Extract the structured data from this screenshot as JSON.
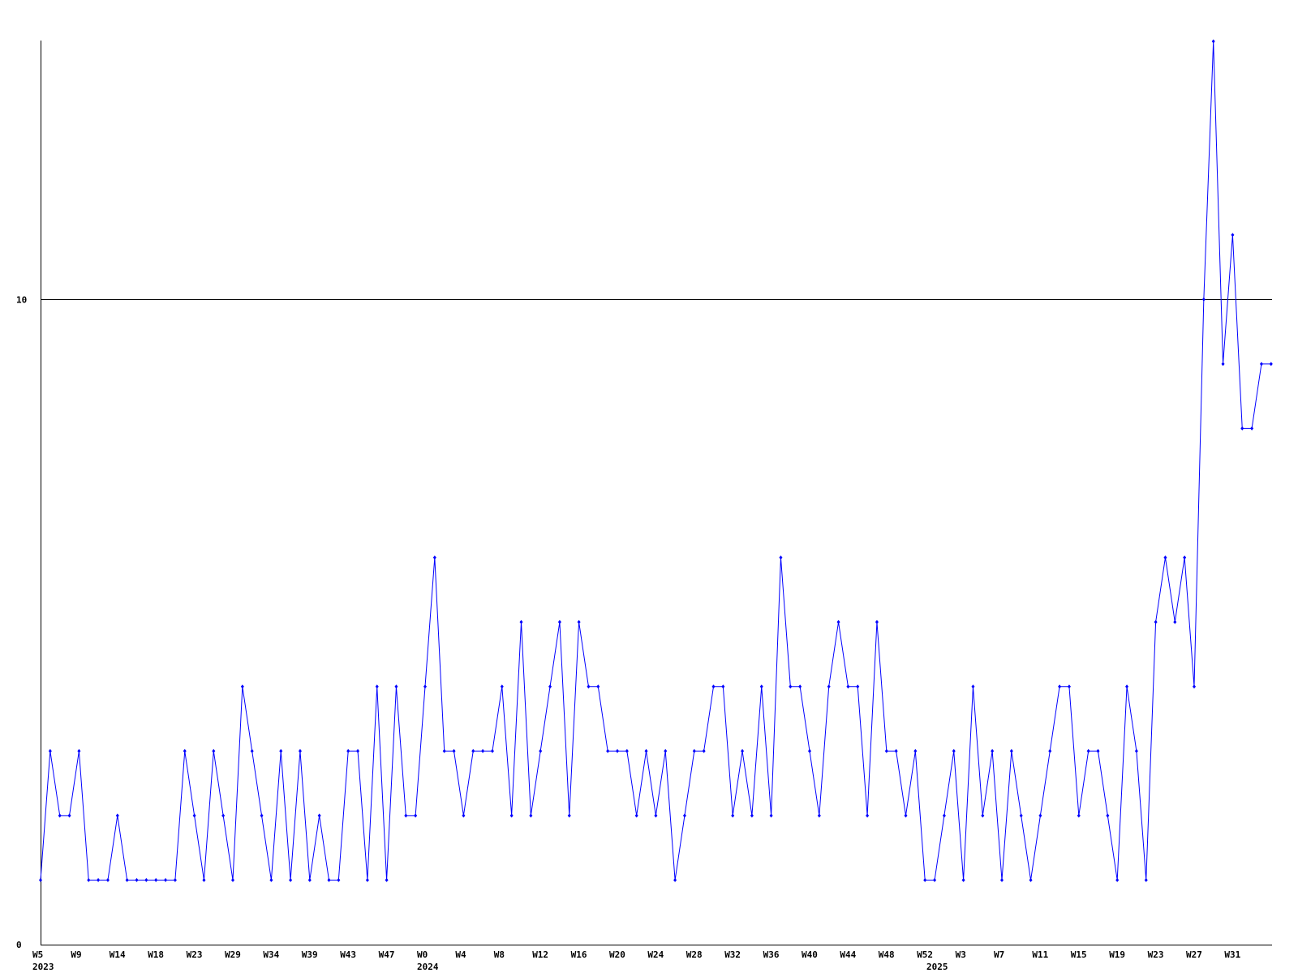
{
  "chart_data": {
    "type": "line",
    "title": "",
    "xlabel": "",
    "ylabel": "",
    "ylim": [
      0,
      14
    ],
    "y_ticks": [
      {
        "value": 0,
        "label": "0"
      },
      {
        "value": 10,
        "label": "10"
      }
    ],
    "grid": {
      "horizontal_at": [
        10
      ]
    },
    "legend": "none",
    "x_tick_labels": [
      {
        "index": 0,
        "label": "W5"
      },
      {
        "index": 4,
        "label": "W9"
      },
      {
        "index": 8,
        "label": "W14"
      },
      {
        "index": 12,
        "label": "W18"
      },
      {
        "index": 16,
        "label": "W23"
      },
      {
        "index": 20,
        "label": "W29"
      },
      {
        "index": 24,
        "label": "W34"
      },
      {
        "index": 28,
        "label": "W39"
      },
      {
        "index": 32,
        "label": "W43"
      },
      {
        "index": 36,
        "label": "W47"
      },
      {
        "index": 40,
        "label": "W0"
      },
      {
        "index": 44,
        "label": "W4"
      },
      {
        "index": 48,
        "label": "W8"
      },
      {
        "index": 52,
        "label": "W12"
      },
      {
        "index": 56,
        "label": "W16"
      },
      {
        "index": 60,
        "label": "W20"
      },
      {
        "index": 64,
        "label": "W24"
      },
      {
        "index": 68,
        "label": "W28"
      },
      {
        "index": 72,
        "label": "W32"
      },
      {
        "index": 76,
        "label": "W36"
      },
      {
        "index": 80,
        "label": "W40"
      },
      {
        "index": 84,
        "label": "W44"
      },
      {
        "index": 88,
        "label": "W48"
      },
      {
        "index": 92,
        "label": "W52"
      },
      {
        "index": 96,
        "label": "W3"
      },
      {
        "index": 100,
        "label": "W7"
      },
      {
        "index": 104,
        "label": "W11"
      },
      {
        "index": 108,
        "label": "W15"
      },
      {
        "index": 112,
        "label": "W19"
      },
      {
        "index": 116,
        "label": "W23"
      },
      {
        "index": 120,
        "label": "W27"
      },
      {
        "index": 124,
        "label": "W31"
      }
    ],
    "year_labels": [
      {
        "index": 0,
        "label": "2023"
      },
      {
        "index": 40,
        "label": "2024"
      },
      {
        "index": 93,
        "label": "2025"
      }
    ],
    "series": [
      {
        "color": "#0000ff",
        "values": [
          1,
          3,
          2,
          2,
          3,
          1,
          1,
          1,
          2,
          1,
          1,
          1,
          1,
          1,
          1,
          3,
          2,
          1,
          3,
          2,
          1,
          4,
          3,
          2,
          1,
          3,
          1,
          3,
          1,
          2,
          1,
          1,
          3,
          3,
          1,
          4,
          1,
          4,
          2,
          2,
          4,
          6,
          3,
          3,
          2,
          3,
          3,
          3,
          4,
          2,
          5,
          2,
          3,
          4,
          5,
          2,
          5,
          4,
          4,
          3,
          3,
          3,
          2,
          3,
          2,
          3,
          1,
          2,
          3,
          3,
          4,
          4,
          2,
          3,
          2,
          4,
          2,
          6,
          4,
          4,
          3,
          2,
          4,
          5,
          4,
          4,
          2,
          5,
          3,
          3,
          2,
          3,
          1,
          1,
          2,
          3,
          1,
          4,
          2,
          3,
          1,
          3,
          2,
          1,
          2,
          3,
          4,
          4,
          2,
          3,
          3,
          2,
          1,
          4,
          3,
          1,
          5,
          6,
          5,
          6,
          4,
          10,
          14,
          9,
          11,
          8,
          8,
          9,
          9
        ]
      }
    ]
  }
}
